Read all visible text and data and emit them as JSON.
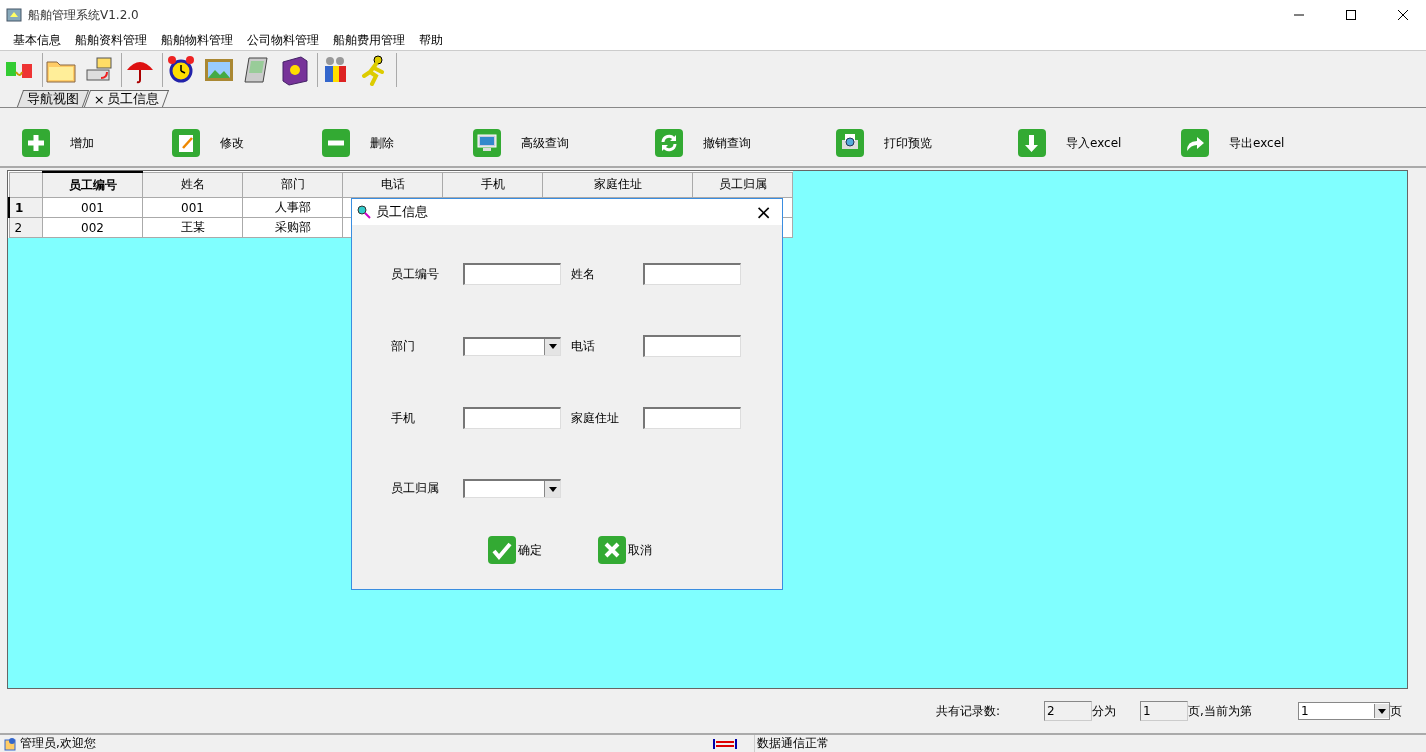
{
  "window": {
    "title": "船舶管理系统V1.2.0"
  },
  "menu": [
    "基本信息",
    "船舶资料管理",
    "船舶物料管理",
    "公司物料管理",
    "船舶费用管理",
    "帮助"
  ],
  "tabs": [
    {
      "label": "导航视图",
      "selected": false
    },
    {
      "label": "员工信息",
      "selected": true,
      "close": "×"
    }
  ],
  "actions": [
    {
      "label": "增加",
      "kind": "add"
    },
    {
      "label": "修改",
      "kind": "edit"
    },
    {
      "label": "删除",
      "kind": "delete"
    },
    {
      "label": "高级查询",
      "kind": "query"
    },
    {
      "label": "撤销查询",
      "kind": "undo"
    },
    {
      "label": "打印预览",
      "kind": "print"
    },
    {
      "label": "导入excel",
      "kind": "import"
    },
    {
      "label": "导出excel",
      "kind": "export"
    }
  ],
  "table": {
    "columns": [
      {
        "label": "员工编号",
        "selected": true
      },
      {
        "label": "姓名",
        "selected": false
      },
      {
        "label": "部门",
        "selected": false
      },
      {
        "label": "电话",
        "selected": false
      },
      {
        "label": "手机",
        "selected": false
      },
      {
        "label": "家庭住址",
        "selected": false
      },
      {
        "label": "员工归属",
        "selected": false
      }
    ],
    "rows": [
      {
        "number": "1",
        "selected": true,
        "cells": [
          "001",
          "001",
          "人事部"
        ]
      },
      {
        "number": "2",
        "selected": false,
        "cells": [
          "002",
          "王某",
          "采购部"
        ]
      }
    ]
  },
  "dialog": {
    "title": "员工信息",
    "close": "×",
    "fields": [
      {
        "label": "员工编号",
        "kind": "text"
      },
      {
        "label": "姓名",
        "kind": "text"
      },
      {
        "label": "部门",
        "kind": "combo"
      },
      {
        "label": "电话",
        "kind": "text"
      },
      {
        "label": "手机",
        "kind": "text"
      },
      {
        "label": "家庭住址",
        "kind": "text"
      },
      {
        "label": "员工归属",
        "kind": "combo"
      }
    ],
    "buttons": [
      {
        "label": "确定",
        "kind": "ok"
      },
      {
        "label": "取消",
        "kind": "cancel"
      }
    ]
  },
  "pagination": {
    "total_label": "共有记录数:",
    "total": "2",
    "pages_label": "分为",
    "pages": "1",
    "current_label": "页,当前为第",
    "current": "1",
    "suffix": "页"
  },
  "status_bar": {
    "user": "管理员,欢迎您",
    "connection": "数据通信正常"
  }
}
